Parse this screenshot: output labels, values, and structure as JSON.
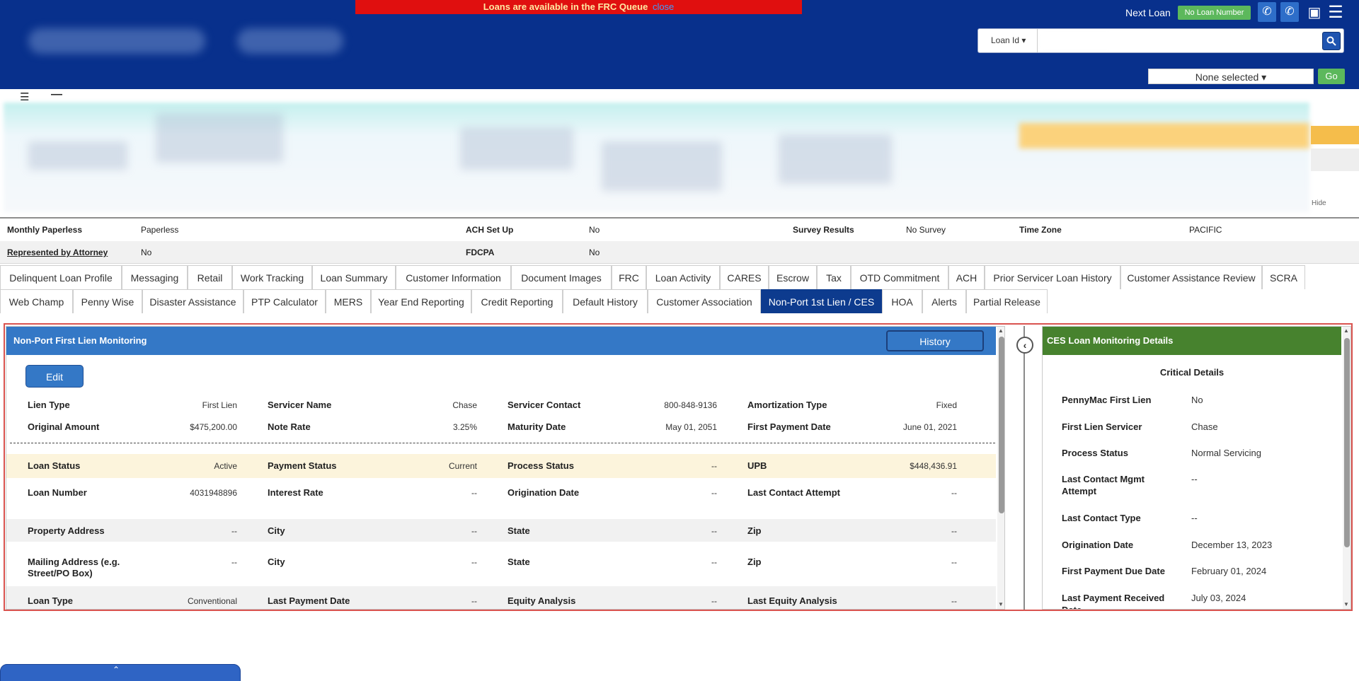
{
  "header": {
    "banner_text": "Loans are available in the FRC Queue",
    "banner_close": "close",
    "next_loan_label": "Next Loan",
    "no_loan_button": "No Loan Number",
    "search_select": "Loan Id ▾",
    "search_placeholder": "",
    "filter_select": "None selected ▾",
    "go_button": "Go",
    "icons": [
      "phone-incoming-icon",
      "phone-outgoing-icon",
      "monitor-icon",
      "menu-icon"
    ]
  },
  "summary": {
    "hide_label": "Hide"
  },
  "info": {
    "row1": {
      "monthly_paperless_label": "Monthly Paperless",
      "monthly_paperless_value": "Paperless",
      "ach_setup_label": "ACH Set Up",
      "ach_setup_value": "No",
      "survey_results_label": "Survey Results",
      "survey_results_value": "No Survey",
      "time_zone_label": "Time Zone",
      "time_zone_value": "PACIFIC"
    },
    "row2": {
      "represented_label": "Represented by Attorney",
      "represented_value": "No",
      "fdcpa_label": "FDCPA",
      "fdcpa_value": "No"
    }
  },
  "tabs": {
    "row1": [
      "Delinquent Loan Profile",
      "Messaging",
      "Retail",
      "Work Tracking",
      "Loan Summary",
      "Customer Information",
      "Document Images",
      "FRC",
      "Loan Activity",
      "CARES",
      "Escrow",
      "Tax",
      "OTD Commitment",
      "ACH",
      "Prior Servicer Loan History",
      "Customer Assistance Review",
      "SCRA"
    ],
    "row2": [
      "Web Champ",
      "Penny Wise",
      "Disaster Assistance",
      "PTP Calculator",
      "MERS",
      "Year End Reporting",
      "Credit Reporting",
      "Default History",
      "Customer Association",
      "Non-Port 1st Lien / CES",
      "HOA",
      "Alerts",
      "Partial Release"
    ],
    "active": "Non-Port 1st Lien / CES"
  },
  "left_panel": {
    "title": "Non-Port First Lien Monitoring",
    "history_button": "History",
    "edit_button": "Edit",
    "fields": {
      "lien_type_label": "Lien Type",
      "lien_type_value": "First Lien",
      "servicer_name_label": "Servicer Name",
      "servicer_name_value": "Chase",
      "servicer_contact_label": "Servicer Contact",
      "servicer_contact_value": "800-848-9136",
      "amortization_type_label": "Amortization Type",
      "amortization_type_value": "Fixed",
      "original_amount_label": "Original Amount",
      "original_amount_value": "$475,200.00",
      "note_rate_label": "Note Rate",
      "note_rate_value": "3.25%",
      "maturity_date_label": "Maturity Date",
      "maturity_date_value": "May 01, 2051",
      "first_payment_date_label": "First Payment Date",
      "first_payment_date_value": "June 01, 2021",
      "loan_status_label": "Loan Status",
      "loan_status_value": "Active",
      "payment_status_label": "Payment Status",
      "payment_status_value": "Current",
      "process_status_label": "Process Status",
      "process_status_value": "--",
      "upb_label": "UPB",
      "upb_value": "$448,436.91",
      "loan_number_label": "Loan Number",
      "loan_number_value": "4031948896",
      "interest_rate_label": "Interest Rate",
      "interest_rate_value": "--",
      "origination_date_label": "Origination Date",
      "origination_date_value": "--",
      "last_contact_attempt_label": "Last Contact Attempt",
      "last_contact_attempt_value": "--",
      "property_address_label": "Property Address",
      "property_address_value": "--",
      "city1_label": "City",
      "city1_value": "--",
      "state1_label": "State",
      "state1_value": "--",
      "zip1_label": "Zip",
      "zip1_value": "--",
      "mailing_address_label": "Mailing Address (e.g. Street/PO Box)",
      "mailing_address_value": "--",
      "city2_label": "City",
      "city2_value": "--",
      "state2_label": "State",
      "state2_value": "--",
      "zip2_label": "Zip",
      "zip2_value": "--",
      "loan_type_label": "Loan Type",
      "loan_type_value": "Conventional",
      "last_payment_date_label": "Last Payment Date",
      "last_payment_date_value": "--",
      "equity_analysis_label": "Equity Analysis",
      "equity_analysis_value": "--",
      "last_equity_analysis_label": "Last Equity Analysis",
      "last_equity_analysis_value": "--"
    }
  },
  "right_panel": {
    "title": "CES Loan Monitoring Details",
    "section_title": "Critical Details",
    "fields": {
      "pennymac_first_lien_label": "PennyMac First Lien",
      "pennymac_first_lien_value": "No",
      "first_lien_servicer_label": "First Lien Servicer",
      "first_lien_servicer_value": "Chase",
      "process_status_label": "Process Status",
      "process_status_value": "Normal Servicing",
      "last_contact_mgmt_label": "Last Contact Mgmt Attempt",
      "last_contact_mgmt_value": "--",
      "last_contact_type_label": "Last Contact Type",
      "last_contact_type_value": "--",
      "origination_date_label": "Origination Date",
      "origination_date_value": "December 13, 2023",
      "first_payment_due_label": "First Payment Due Date",
      "first_payment_due_value": "February 01, 2024",
      "last_payment_received_label": "Last Payment Received Date",
      "last_payment_received_value": "July 03, 2024"
    }
  },
  "colors": {
    "header_bg": "#08308c",
    "banner_bg": "#e00f0f",
    "panel_blue": "#3478c6",
    "panel_green": "#47822e",
    "active_tab": "#0d3b8e",
    "button_green": "#5cb85c",
    "frame_red": "#d9534f"
  }
}
